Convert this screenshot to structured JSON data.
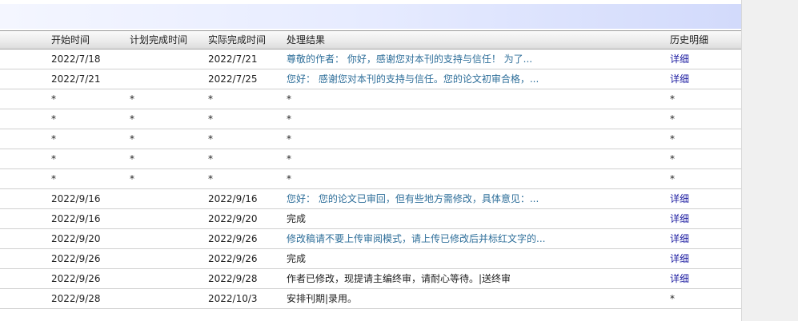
{
  "table": {
    "headers": {
      "start_time": "开始时间",
      "planned_completion": "计划完成时间",
      "actual_completion": "实际完成时间",
      "result": "处理结果",
      "history": "历史明细"
    },
    "rows": [
      {
        "start": "2022/7/18",
        "plan": "",
        "actual": "2022/7/21",
        "result": "尊敬的作者： 你好，感谢您对本刊的支持与信任！ 为了...",
        "result_link": true,
        "history": "详细",
        "history_link": true
      },
      {
        "start": "2022/7/21",
        "plan": "",
        "actual": "2022/7/25",
        "result": "您好： 感谢您对本刊的支持与信任。您的论文初审合格，...",
        "result_link": true,
        "history": "详细",
        "history_link": true
      },
      {
        "start": "*",
        "plan": "*",
        "actual": "*",
        "result": "*",
        "result_link": false,
        "history": "*",
        "history_link": false
      },
      {
        "start": "*",
        "plan": "*",
        "actual": "*",
        "result": "*",
        "result_link": false,
        "history": "*",
        "history_link": false
      },
      {
        "start": "*",
        "plan": "*",
        "actual": "*",
        "result": "*",
        "result_link": false,
        "history": "*",
        "history_link": false
      },
      {
        "start": "*",
        "plan": "*",
        "actual": "*",
        "result": "*",
        "result_link": false,
        "history": "*",
        "history_link": false
      },
      {
        "start": "*",
        "plan": "*",
        "actual": "*",
        "result": "*",
        "result_link": false,
        "history": "*",
        "history_link": false
      },
      {
        "start": "2022/9/16",
        "plan": "",
        "actual": "2022/9/16",
        "result": "您好： 您的论文已审回，但有些地方需修改，具体意见：...",
        "result_link": true,
        "history": "详细",
        "history_link": true
      },
      {
        "start": "2022/9/16",
        "plan": "",
        "actual": "2022/9/20",
        "result": "完成",
        "result_link": false,
        "history": "详细",
        "history_link": true
      },
      {
        "start": "2022/9/20",
        "plan": "",
        "actual": "2022/9/26",
        "result": "修改稿请不要上传审阅模式，请上传已修改后并标红文字的...",
        "result_link": true,
        "history": "详细",
        "history_link": true
      },
      {
        "start": "2022/9/26",
        "plan": "",
        "actual": "2022/9/26",
        "result": "完成",
        "result_link": false,
        "history": "详细",
        "history_link": true
      },
      {
        "start": "2022/9/26",
        "plan": "",
        "actual": "2022/9/28",
        "result": "作者已修改，现提请主编终审，请耐心等待。|送终审",
        "result_link": false,
        "history": "详细",
        "history_link": true
      },
      {
        "start": "2022/9/28",
        "plan": "",
        "actual": "2022/10/3",
        "result": "安排刊期|录用。",
        "result_link": false,
        "history": "*",
        "history_link": false
      }
    ]
  }
}
